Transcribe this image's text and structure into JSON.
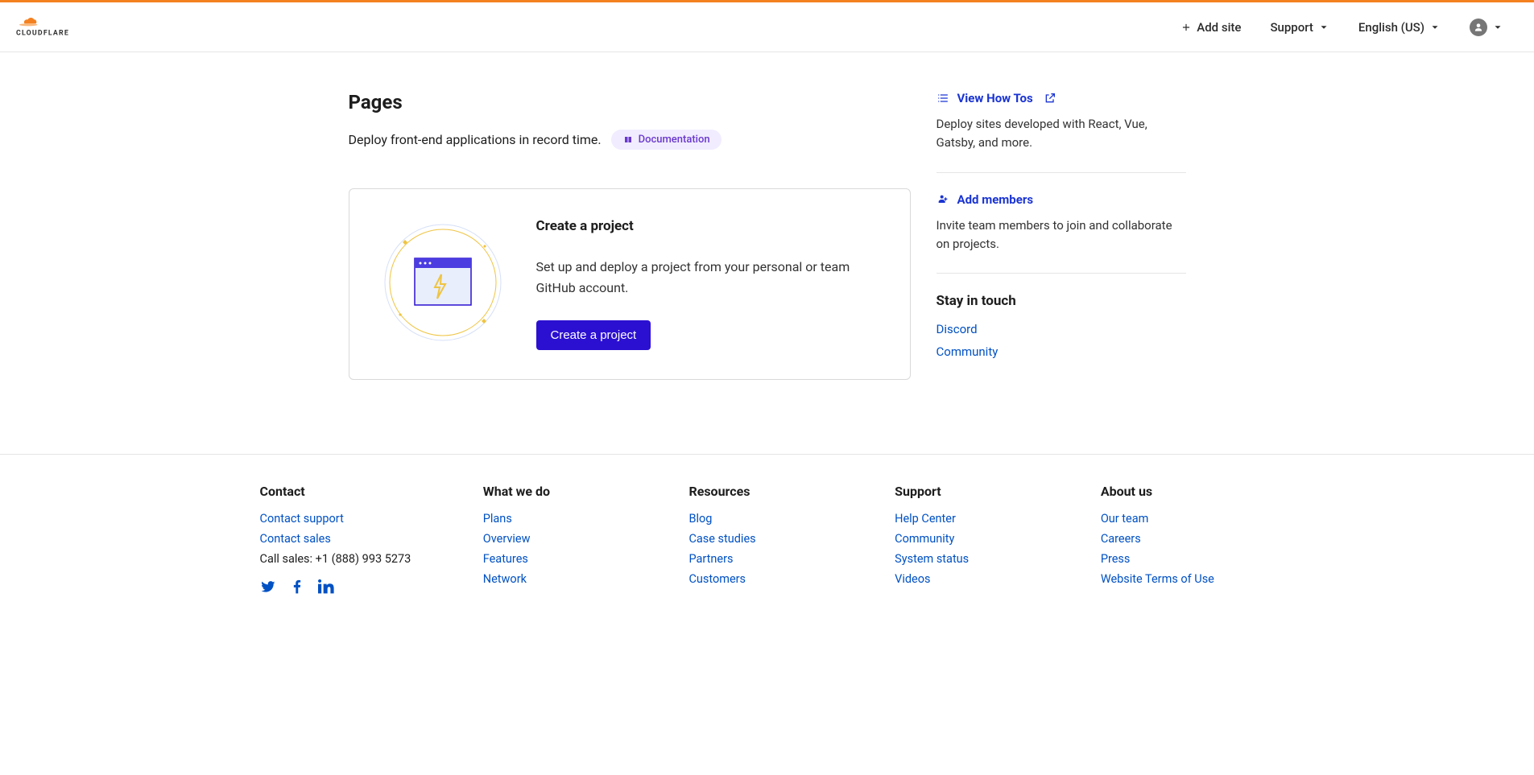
{
  "header": {
    "add_site": "Add site",
    "support": "Support",
    "language": "English (US)"
  },
  "page": {
    "title": "Pages",
    "subtitle": "Deploy front-end applications in record time.",
    "doc_label": "Documentation"
  },
  "create_card": {
    "heading": "Create a project",
    "description": "Set up and deploy a project from your personal or team GitHub account.",
    "button": "Create a project"
  },
  "sidebar": {
    "howtos": {
      "label": "View How Tos",
      "desc": "Deploy sites developed with React, Vue, Gatsby, and more."
    },
    "members": {
      "label": "Add members",
      "desc": "Invite team members to join and collaborate on projects."
    },
    "stay_heading": "Stay in touch",
    "discord": "Discord",
    "community": "Community"
  },
  "footer": {
    "contact": {
      "heading": "Contact",
      "support": "Contact support",
      "sales": "Contact sales",
      "call": "Call sales: +1 (888) 993 5273"
    },
    "what_we_do": {
      "heading": "What we do",
      "links": [
        "Plans",
        "Overview",
        "Features",
        "Network"
      ]
    },
    "resources": {
      "heading": "Resources",
      "links": [
        "Blog",
        "Case studies",
        "Partners",
        "Customers"
      ]
    },
    "support": {
      "heading": "Support",
      "links": [
        "Help Center",
        "Community",
        "System status",
        "Videos"
      ]
    },
    "about": {
      "heading": "About us",
      "links": [
        "Our team",
        "Careers",
        "Press",
        "Website Terms of Use"
      ]
    }
  }
}
